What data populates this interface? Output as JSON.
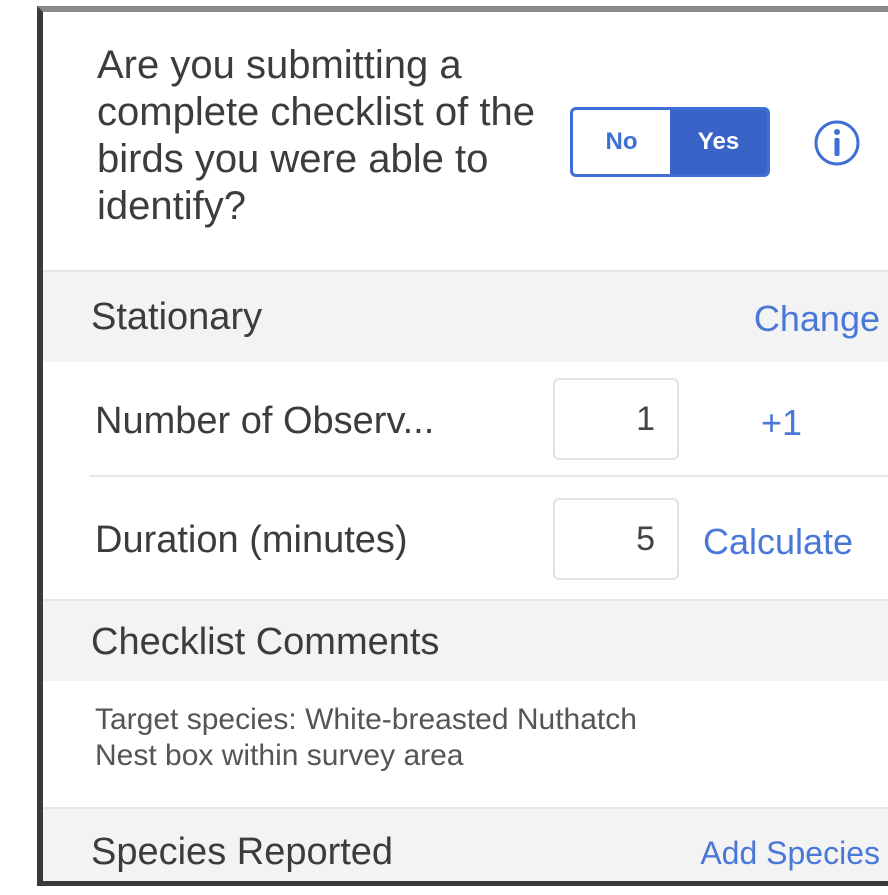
{
  "complete_checklist": {
    "question": "Are you submitting a complete checklist of the birds you were able to identify?",
    "toggle_no": "No",
    "toggle_yes": "Yes",
    "selected": "Yes",
    "info_icon": "info-icon"
  },
  "protocol": {
    "title": "Stationary",
    "change_label": "Change"
  },
  "observers": {
    "label": "Number of Observ...",
    "value": "1",
    "increment_label": "+1"
  },
  "duration": {
    "label": "Duration (minutes)",
    "value": "5",
    "calculate_label": "Calculate"
  },
  "comments": {
    "title": "Checklist Comments",
    "lines": [
      "Target species: White-breasted Nuthatch",
      "Nest box within survey area"
    ]
  },
  "species": {
    "title": "Species Reported",
    "add_label": "Add Species"
  },
  "colors": {
    "accent": "#3a63c7",
    "link": "#4a78d8",
    "section_bg": "#f3f3f3"
  }
}
